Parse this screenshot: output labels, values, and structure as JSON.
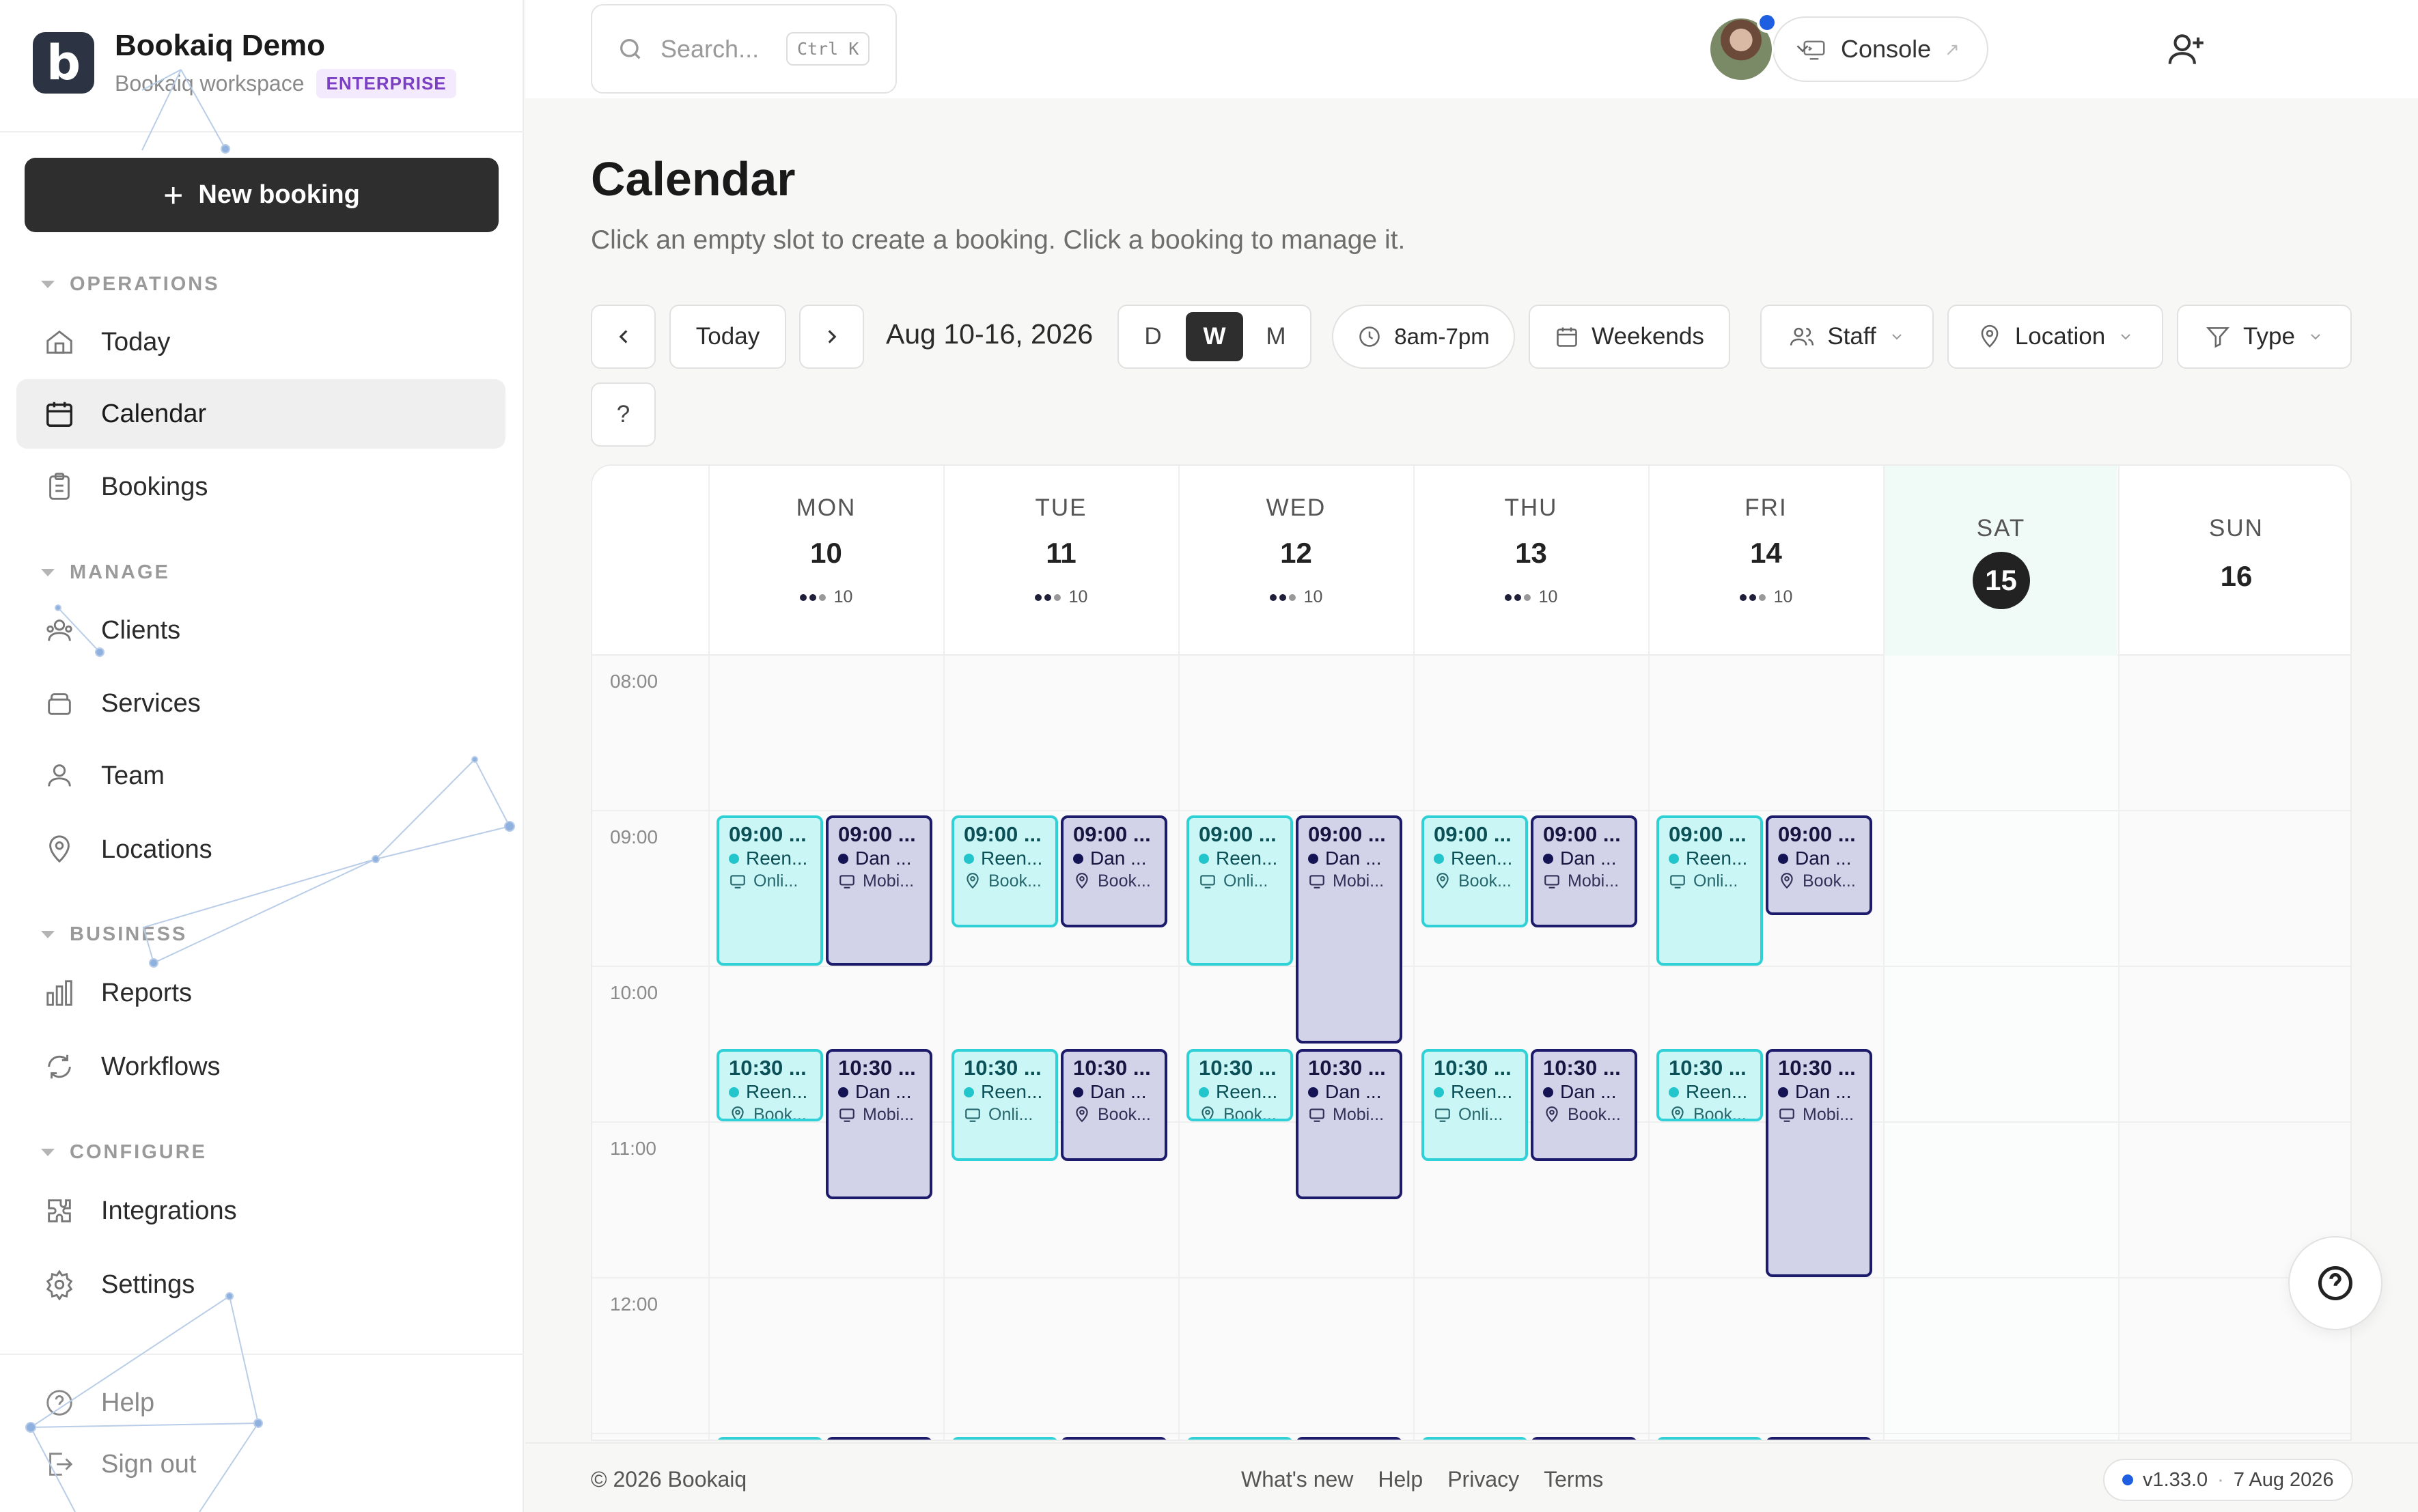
{
  "brand": {
    "title": "Bookaiq Demo",
    "workspace": "Bookaiq workspace",
    "plan": "ENTERPRISE",
    "logo_letter": "b"
  },
  "sidebar": {
    "new_booking": "New booking",
    "sections": {
      "operations": "OPERATIONS",
      "manage": "MANAGE",
      "business": "BUSINESS",
      "configure": "CONFIGURE"
    },
    "items": {
      "today": "Today",
      "calendar": "Calendar",
      "bookings": "Bookings",
      "clients": "Clients",
      "services": "Services",
      "team": "Team",
      "locations": "Locations",
      "reports": "Reports",
      "workflows": "Workflows",
      "integrations": "Integrations",
      "settings": "Settings",
      "help": "Help",
      "sign_out": "Sign out"
    }
  },
  "topbar": {
    "search_placeholder": "Search...",
    "search_shortcut": "Ctrl K",
    "console": "Console"
  },
  "page": {
    "title": "Calendar",
    "subtitle": "Click an empty slot to create a booking. Click a booking to manage it."
  },
  "toolbar": {
    "today": "Today",
    "date_range": "Aug 10-16, 2026",
    "view_d": "D",
    "view_w": "W",
    "view_m": "M",
    "hours": "8am-7pm",
    "weekends": "Weekends",
    "staff": "Staff",
    "location": "Location",
    "type": "Type",
    "help": "?"
  },
  "calendar": {
    "days": [
      {
        "name": "MON",
        "num": "10",
        "count": "10"
      },
      {
        "name": "TUE",
        "num": "11",
        "count": "10"
      },
      {
        "name": "WED",
        "num": "12",
        "count": "10"
      },
      {
        "name": "THU",
        "num": "13",
        "count": "10"
      },
      {
        "name": "FRI",
        "num": "14",
        "count": "10"
      },
      {
        "name": "SAT",
        "num": "15"
      },
      {
        "name": "SUN",
        "num": "16"
      }
    ],
    "hours": [
      "08:00",
      "09:00",
      "10:00",
      "11:00",
      "12:00"
    ],
    "event_text": {
      "t900": "09:00 ...",
      "t1030": "10:30 ...",
      "reen": "Reen...",
      "dan": "Dan ...",
      "onli": "Onli...",
      "mobi": "Mobi...",
      "book": "Book..."
    },
    "colors": {
      "cyan": "#2fd0d6",
      "navy": "#1c1a6b"
    }
  },
  "footer": {
    "copyright": "© 2026 Bookaiq",
    "whats_new": "What's new",
    "help": "Help",
    "privacy": "Privacy",
    "terms": "Terms",
    "version": "v1.33.0",
    "date": "7 Aug 2026"
  }
}
